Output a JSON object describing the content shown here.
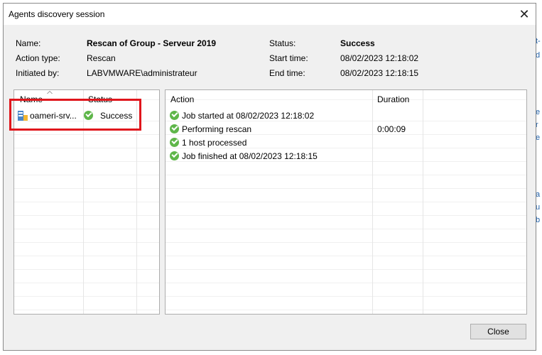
{
  "window": {
    "title": "Agents discovery session"
  },
  "info": {
    "name_label": "Name:",
    "name_value": "Rescan of Group - Serveur 2019",
    "action_type_label": "Action type:",
    "action_type_value": "Rescan",
    "initiated_by_label": "Initiated by:",
    "initiated_by_value": "LABVMWARE\\administrateur",
    "status_label": "Status:",
    "status_value": "Success",
    "start_time_label": "Start time:",
    "start_time_value": "08/02/2023 12:18:02",
    "end_time_label": "End time:",
    "end_time_value": "08/02/2023 12:18:15"
  },
  "objects_table": {
    "columns": [
      "Name",
      "Status"
    ],
    "rows": [
      {
        "name": "oameri-srv...",
        "status": "Success",
        "icon": "server-icon"
      }
    ]
  },
  "actions_table": {
    "columns": [
      "Action",
      "Duration"
    ],
    "rows": [
      {
        "action": "Job started at 08/02/2023 12:18:02",
        "duration": ""
      },
      {
        "action": "Performing rescan",
        "duration": "0:00:09"
      },
      {
        "action": "1 host processed",
        "duration": ""
      },
      {
        "action": "Job finished at 08/02/2023 12:18:15",
        "duration": ""
      }
    ]
  },
  "buttons": {
    "close_label": "Close"
  },
  "background": {
    "fragments": [
      "t-",
      "d",
      "e",
      "r",
      "e",
      "a",
      "u",
      "b"
    ]
  },
  "colors": {
    "success_green": "#5fb64a",
    "highlight_red": "#e0161c"
  }
}
